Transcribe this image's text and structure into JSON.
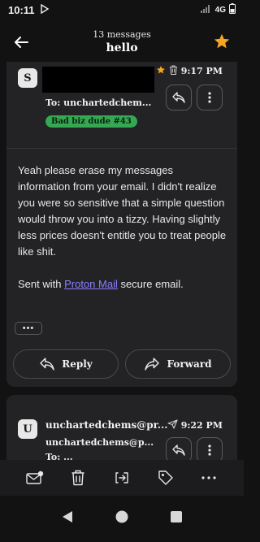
{
  "status": {
    "time": "10:11",
    "network": "4G"
  },
  "header": {
    "count": "13 messages",
    "subject": "hello"
  },
  "message1": {
    "avatar": "S",
    "to": "To: unchartedchem...",
    "label": "Bad biz dude #43",
    "time": "9:17 PM",
    "body": [
      "Yeah please erase my messages information from your email. I didn't realize you were so sensitive that a simple question would throw you into a tizzy. Having slightly less prices doesn't entitle you to treat people like shit."
    ],
    "signature_prefix": "Sent with ",
    "signature_link": "Proton Mail",
    "signature_suffix": " secure email.",
    "more": "•••",
    "reply_label": "Reply",
    "forward_label": "Forward"
  },
  "message2": {
    "avatar": "U",
    "sender": "unchartedchems@pr...",
    "sender_email": "unchartedchems@p...",
    "time": "9:22 PM",
    "to": "To: ..."
  },
  "colors": {
    "accent": "#f5a623",
    "link": "#8b7fff",
    "label": "#34a853"
  }
}
